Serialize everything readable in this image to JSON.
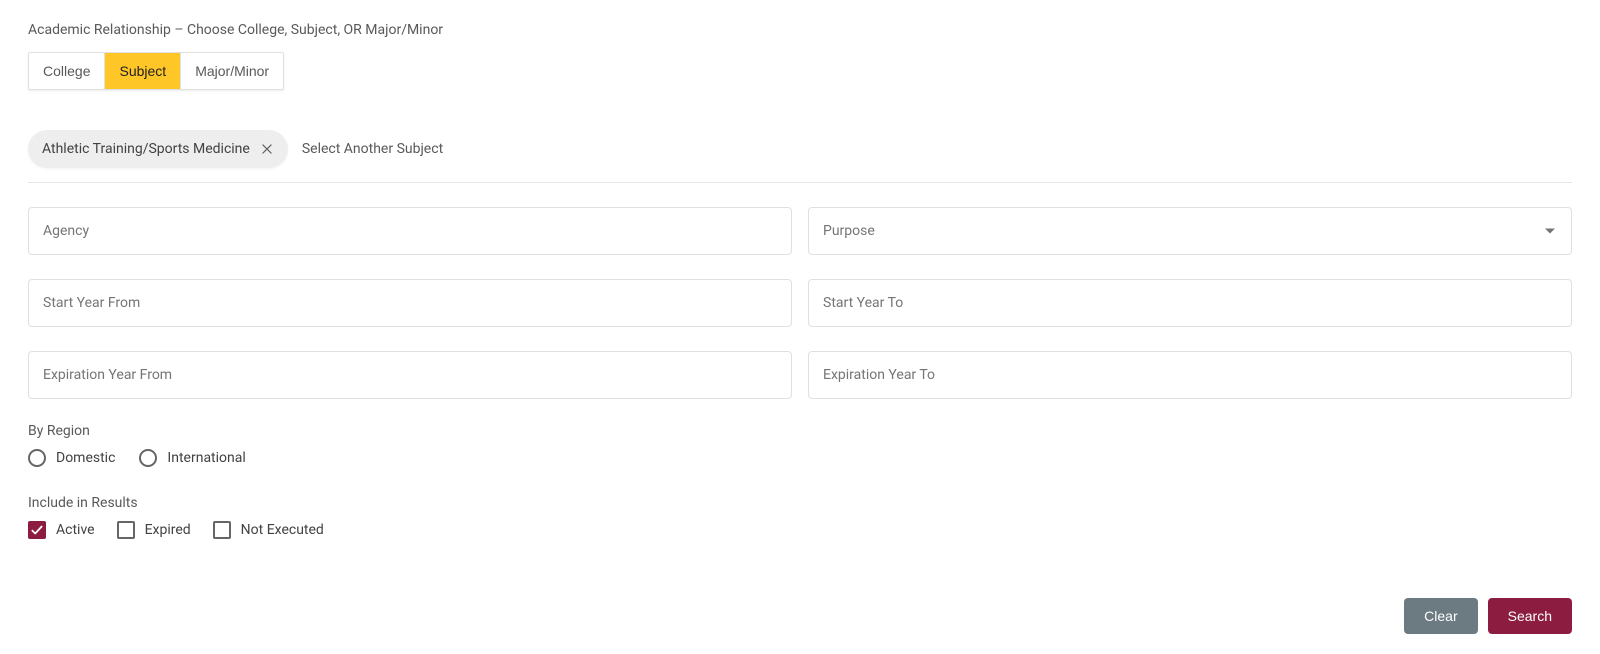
{
  "section_title": "Academic Relationship – Choose College, Subject, OR Major/Minor",
  "tabs": {
    "college": "College",
    "subject": "Subject",
    "major_minor": "Major/Minor",
    "active": "subject"
  },
  "selected_chip": "Athletic Training/Sports Medicine",
  "select_another_label": "Select Another Subject",
  "fields": {
    "agency": {
      "label": "Agency"
    },
    "purpose": {
      "label": "Purpose"
    },
    "start_year_from": {
      "label": "Start Year From"
    },
    "start_year_to": {
      "label": "Start Year To"
    },
    "exp_year_from": {
      "label": "Expiration Year From"
    },
    "exp_year_to": {
      "label": "Expiration Year To"
    }
  },
  "region": {
    "label": "By Region",
    "domestic": "Domestic",
    "international": "International"
  },
  "include": {
    "label": "Include in Results",
    "active": {
      "label": "Active",
      "checked": true
    },
    "expired": {
      "label": "Expired",
      "checked": false
    },
    "not_executed": {
      "label": "Not Executed",
      "checked": false
    }
  },
  "buttons": {
    "clear": "Clear",
    "search": "Search"
  }
}
